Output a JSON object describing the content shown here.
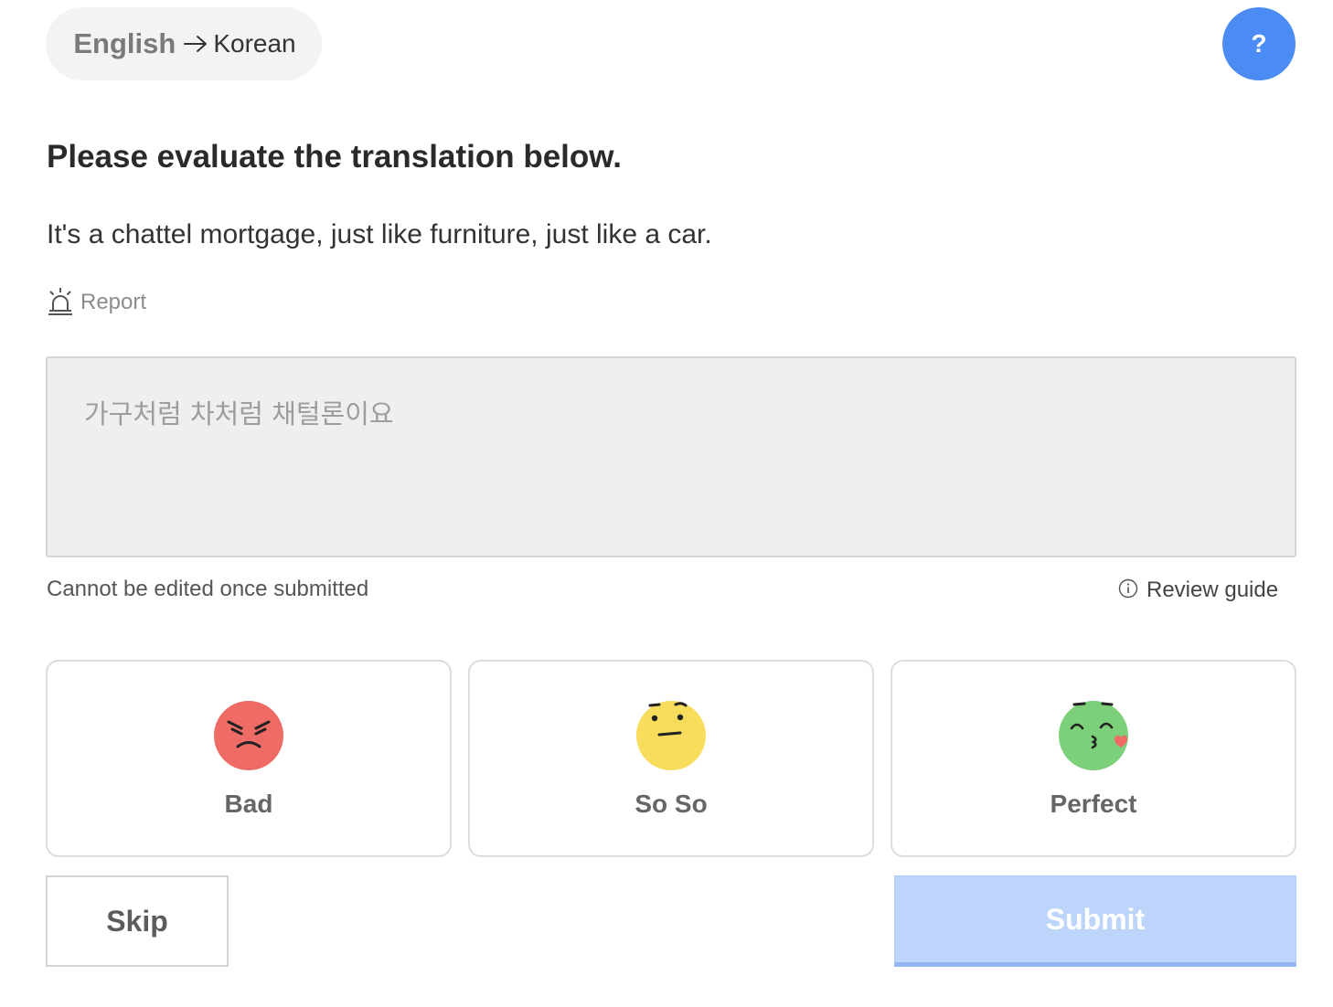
{
  "language_pair": {
    "source": "English",
    "target": "Korean"
  },
  "help_button_label": "?",
  "prompt": "Please evaluate the translation below.",
  "source_sentence": "It's a chattel mortgage, just like furniture, just like a car.",
  "report_label": "Report",
  "translation_text": "가구처럼 차처럼 채털론이요",
  "note": "Cannot be edited once submitted",
  "review_guide_label": "Review guide",
  "ratings": [
    {
      "label": "Bad",
      "icon": "angry-face-icon",
      "color": "#ee6b66"
    },
    {
      "label": "So So",
      "icon": "skeptical-face-icon",
      "color": "#f8dc5c"
    },
    {
      "label": "Perfect",
      "icon": "kissing-face-icon",
      "color": "#7dd07a"
    }
  ],
  "skip_label": "Skip",
  "submit_label": "Submit",
  "colors": {
    "accent": "#4b8bf4",
    "submit_disabled": "#bdd5fb"
  }
}
